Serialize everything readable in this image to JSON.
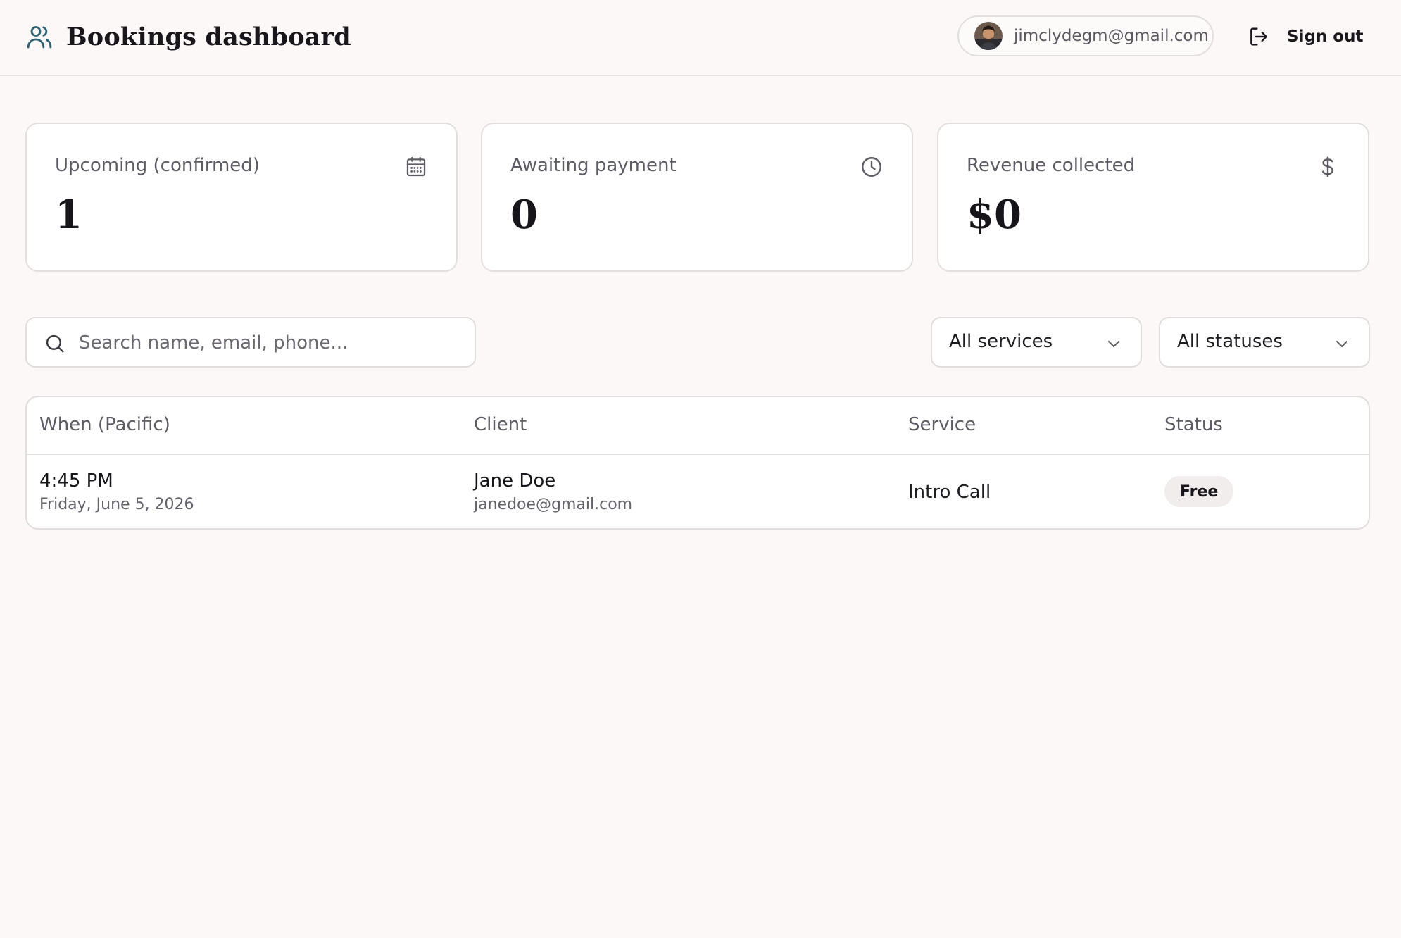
{
  "header": {
    "title": "Bookings dashboard",
    "brand_icon": "users-icon",
    "account_email": "jimclydegm@gmail.com",
    "sign_out_label": "Sign out",
    "sign_out_icon": "sign-out-icon"
  },
  "stats": [
    {
      "label": "Upcoming (confirmed)",
      "value": "1",
      "icon": "calendar-icon"
    },
    {
      "label": "Awaiting payment",
      "value": "0",
      "icon": "clock-icon"
    },
    {
      "label": "Revenue collected",
      "value": "$0",
      "icon": "dollar-icon"
    }
  ],
  "filters": {
    "search_placeholder": "Search name, email, phone...",
    "service_selected": "All services",
    "status_selected": "All statuses"
  },
  "table": {
    "columns": [
      "When (Pacific)",
      "Client",
      "Service",
      "Status"
    ],
    "rows": [
      {
        "time": "4:45 PM",
        "date": "Friday, June 5, 2026",
        "client_name": "Jane Doe",
        "client_email": "janedoe@gmail.com",
        "service": "Intro Call",
        "status": "Free"
      }
    ]
  },
  "colors": {
    "background": "#fcf8f8",
    "brand_accent": "#2f6173",
    "card_border": "#e4dfdf",
    "badge_background": "#f1eded"
  }
}
